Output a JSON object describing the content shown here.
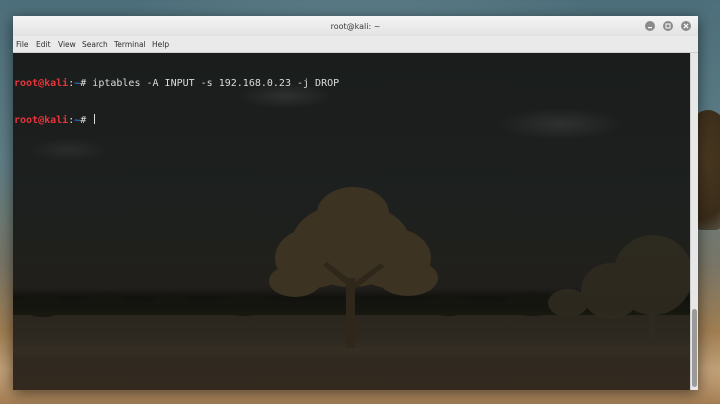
{
  "window": {
    "title": "root@kali: ~"
  },
  "menubar": {
    "items": [
      {
        "label": "File"
      },
      {
        "label": "Edit"
      },
      {
        "label": "View"
      },
      {
        "label": "Search"
      },
      {
        "label": "Terminal"
      },
      {
        "label": "Help"
      }
    ]
  },
  "terminal": {
    "lines": [
      {
        "user_host": "root@kali",
        "separator": ":",
        "path": "~",
        "sign": "# ",
        "command": "iptables -A INPUT -s 192.168.0.23 -j DROP"
      },
      {
        "user_host": "root@kali",
        "separator": ":",
        "path": "~",
        "sign": "# ",
        "command": ""
      }
    ]
  },
  "colors": {
    "prompt_user_host": "#e8343b",
    "prompt_path": "#3c6fd6",
    "terminal_text": "#dcdcdc",
    "titlebar_button": "#8a8a8a"
  },
  "icons": {
    "minimize": "minimize-icon",
    "maximize": "maximize-icon",
    "close": "close-icon"
  }
}
